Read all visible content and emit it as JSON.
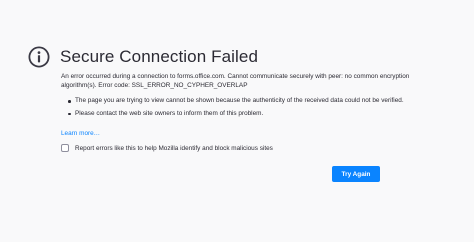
{
  "error": {
    "title": "Secure Connection Failed",
    "description": "An error occurred during a connection to forms.office.com. Cannot communicate securely with peer: no common encryption algorithm(s). Error code: SSL_ERROR_NO_CYPHER_OVERLAP",
    "points": [
      "The page you are trying to view cannot be shown because the authenticity of the received data could not be verified.",
      "Please contact the web site owners to inform them of this problem."
    ],
    "learn_more": "Learn more…",
    "report_label": "Report errors like this to help Mozilla identify and block malicious sites",
    "report_checked": false,
    "try_again_label": "Try Again",
    "icon": "info-icon"
  },
  "colors": {
    "background": "#f9f9fa",
    "accent": "#0a84ff",
    "text": "#2b2a33"
  }
}
